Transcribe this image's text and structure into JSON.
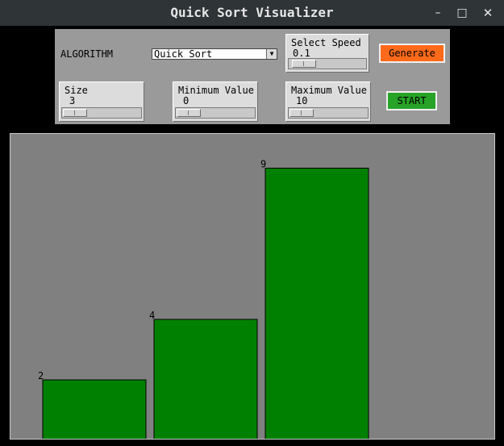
{
  "window": {
    "title": "Quick Sort Visualizer",
    "min_glyph": "–",
    "max_glyph": "□",
    "close_glyph": "✕"
  },
  "controls": {
    "algorithm_label": "ALGORITHM",
    "algorithm_selected": "Quick Sort",
    "speed": {
      "label": "Select Speed",
      "value": "0.1"
    },
    "size": {
      "label": "Size",
      "value": "3"
    },
    "min_value": {
      "label": "Minimum Value",
      "value": "0"
    },
    "max_value": {
      "label": "Maximum Value",
      "value": "10"
    },
    "generate_label": "Generate",
    "start_label": "START",
    "generate_color": "#ff6a1a",
    "start_color": "#27a327"
  },
  "chart_data": {
    "type": "bar",
    "values": [
      2,
      4,
      9
    ],
    "bar_color": "#008000",
    "background": "#808080"
  }
}
